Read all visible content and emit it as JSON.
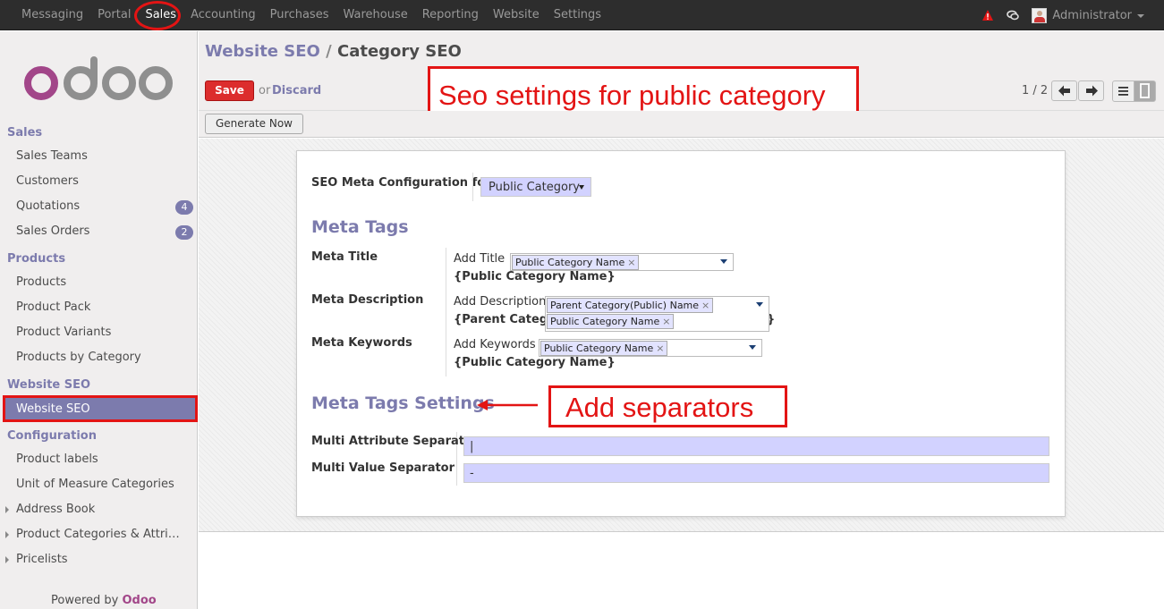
{
  "topbar": {
    "menu": [
      "Messaging",
      "Portal",
      "Sales",
      "Accounting",
      "Purchases",
      "Warehouse",
      "Reporting",
      "Website",
      "Settings"
    ],
    "active": "Sales",
    "user": "Administrator",
    "icons": [
      "warning-icon",
      "chat-icon",
      "avatar"
    ]
  },
  "sidebar": {
    "logo": "odoo",
    "sales_section": "Sales",
    "sales_items": [
      "Sales Teams",
      "Customers",
      "Quotations",
      "Sales Orders"
    ],
    "quotations_badge": "4",
    "sales_orders_badge": "2",
    "products_section": "Products",
    "products_items": [
      "Products",
      "Product Pack",
      "Product Variants",
      "Products by Category"
    ],
    "seo_section": "Website SEO",
    "seo_item": "Website SEO",
    "config_section": "Configuration",
    "config_items": [
      "Product labels",
      "Unit of Measure Categories",
      "Address Book",
      "Product Categories & Attri…",
      "Pricelists"
    ],
    "powered_by": "Powered by",
    "powered_brand": "Odoo"
  },
  "header": {
    "breadcrumb_parent": "Website SEO",
    "breadcrumb_sep": "/",
    "breadcrumb_current": "Category SEO",
    "save": "Save",
    "or": "or",
    "discard": "Discard",
    "pager": "1 / 2"
  },
  "toolbar": {
    "generate": "Generate Now"
  },
  "annotations": {
    "top": "Seo settings for public category",
    "separators": "Add separators"
  },
  "form": {
    "config_label": "SEO Meta Configuration for",
    "config_value": "Public Category",
    "meta_tags_heading": "Meta Tags",
    "meta_title_label": "Meta Title",
    "add_title": "Add Title",
    "title_tag": "Public Category Name",
    "title_preview": "{Public Category Name}",
    "meta_desc_label": "Meta Description",
    "add_description": "Add Description",
    "desc_tag1": "Parent Category(Public) Name",
    "desc_tag2": "Public Category Name",
    "desc_preview": "{Parent Category",
    "desc_preview_end": "}",
    "meta_keywords_label": "Meta Keywords",
    "add_keywords": "Add Keywords",
    "keywords_tag": "Public Category Name",
    "keywords_preview": "{Public Category Name}",
    "settings_heading": "Meta Tags Settings",
    "multi_attr_label": "Multi Attribute Separator",
    "multi_attr_value": "|",
    "multi_value_label": "Multi Value Separator",
    "multi_value_value": "-"
  },
  "colors": {
    "accent": "#7c7bad",
    "annotation_red": "#e31414",
    "save_red": "#dc2d2d",
    "brand": "#a24689"
  }
}
